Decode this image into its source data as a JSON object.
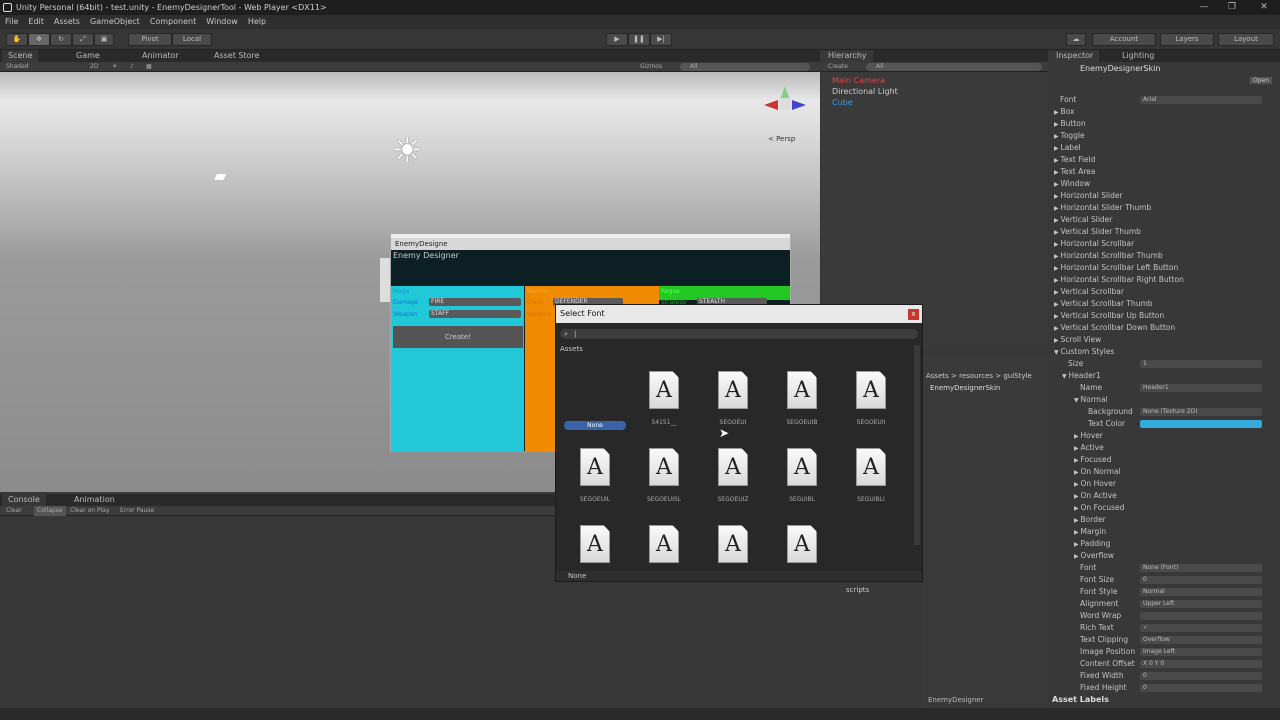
{
  "window": {
    "title": "Unity Personal (64bit) - test.unity - EnemyDesignerTool - Web Player <DX11>"
  },
  "menu": [
    "File",
    "Edit",
    "Assets",
    "GameObject",
    "Component",
    "Window",
    "Help"
  ],
  "toolbar": {
    "pivot": "Pivot",
    "local": "Local",
    "account": "Account",
    "layers": "Layers",
    "layout": "Layout"
  },
  "scene_tabs": {
    "scene": "Scene",
    "game": "Game",
    "animator": "Animator",
    "asset_store": "Asset Store",
    "shaded": "Shaded",
    "mode2d": "2D",
    "gizmos": "Gizmos",
    "search": "All",
    "persp": "< Persp"
  },
  "game": {
    "window_title": "EnemyDesigne",
    "header": "Enemy Designer",
    "cols": [
      {
        "name": "Mage",
        "color": "#21c8d8"
      },
      {
        "name": "Warrior",
        "color": "#f08a00"
      },
      {
        "name": "Rogue",
        "color": "#22c922"
      }
    ],
    "mage_damage_label": "Damage",
    "mage_damage": "FIRE",
    "mage_weapon_label": "Weapon",
    "mage_weapon": "STAFF",
    "warrior_class_label": "Class",
    "warrior_class": "DEFENDER",
    "warrior_weapon_label": "Weapon",
    "rogue_strategy_label": "Strategy",
    "rogue_strategy": "STEALTH",
    "create": "Create!"
  },
  "dialog": {
    "title": "Select Font",
    "search_placeholder": "|",
    "section": "Assets",
    "footer": "None",
    "close": "x",
    "items": [
      "None",
      "54151__",
      "SEGOEUI",
      "SEGOEUIB",
      "SEGOEUII",
      "SEGOEUIL",
      "SEGOEUISL",
      "SEGOEUIZ",
      "SEGUIBL",
      "SEGUIBLI",
      "",
      "",
      "",
      ""
    ]
  },
  "hierarchy": {
    "title": "Hierarchy",
    "create": "Create",
    "search": "All",
    "items": [
      "Main Camera",
      "Directional Light",
      "Cube"
    ]
  },
  "project": {
    "breadcrumb": "Assets > resources > guiStyle",
    "item": "EnemyDesignerSkin",
    "folder": "scripts",
    "status": "EnemyDesigner"
  },
  "console": {
    "console_tab": "Console",
    "animation_tab": "Animation",
    "clear": "Clear",
    "collapse": "Collapse",
    "clear_on_play": "Clear on Play",
    "error_pause": "Error Pause"
  },
  "inspector": {
    "title": "Inspector",
    "lighting": "Lighting",
    "object": "EnemyDesignerSkin",
    "open": "Open",
    "font_label": "Font",
    "font_value": "Arial",
    "styles": [
      "Box",
      "Button",
      "Toggle",
      "Label",
      "Text Field",
      "Text Area",
      "Window",
      "Horizontal Slider",
      "Horizontal Slider Thumb",
      "Vertical Slider",
      "Vertical Slider Thumb",
      "Horizontal Scrollbar",
      "Horizontal Scrollbar Thumb",
      "Horizontal Scrollbar Left Button",
      "Horizontal Scrollbar Right Button",
      "Vertical Scrollbar",
      "Vertical Scrollbar Thumb",
      "Vertical Scrollbar Up Button",
      "Vertical Scrollbar Down Button",
      "Scroll View"
    ],
    "custom_styles": "Custom Styles",
    "size_label": "Size",
    "size": "1",
    "element": "Header1",
    "name_label": "Name",
    "name": "Header1",
    "normal": "Normal",
    "background_label": "Background",
    "background": "None (Texture 2D)",
    "text_color_label": "Text Color",
    "text_color": "#33aadd",
    "states": [
      "Hover",
      "Active",
      "Focused",
      "On Normal",
      "On Hover",
      "On Active",
      "On Focused",
      "Border",
      "Margin",
      "Padding",
      "Overflow"
    ],
    "props": [
      [
        "Font",
        "None (Font)"
      ],
      [
        "Font Size",
        "0"
      ],
      [
        "Font Style",
        "Normal"
      ],
      [
        "Alignment",
        "Upper Left"
      ],
      [
        "Word Wrap",
        ""
      ],
      [
        "Rich Text",
        "✓"
      ],
      [
        "Text Clipping",
        "Overflow"
      ],
      [
        "Image Position",
        "Image Left"
      ],
      [
        "Content Offset",
        "X 0      Y 0"
      ],
      [
        "Fixed Width",
        "0"
      ],
      [
        "Fixed Height",
        "0"
      ]
    ],
    "asset_labels": "Asset Labels"
  }
}
